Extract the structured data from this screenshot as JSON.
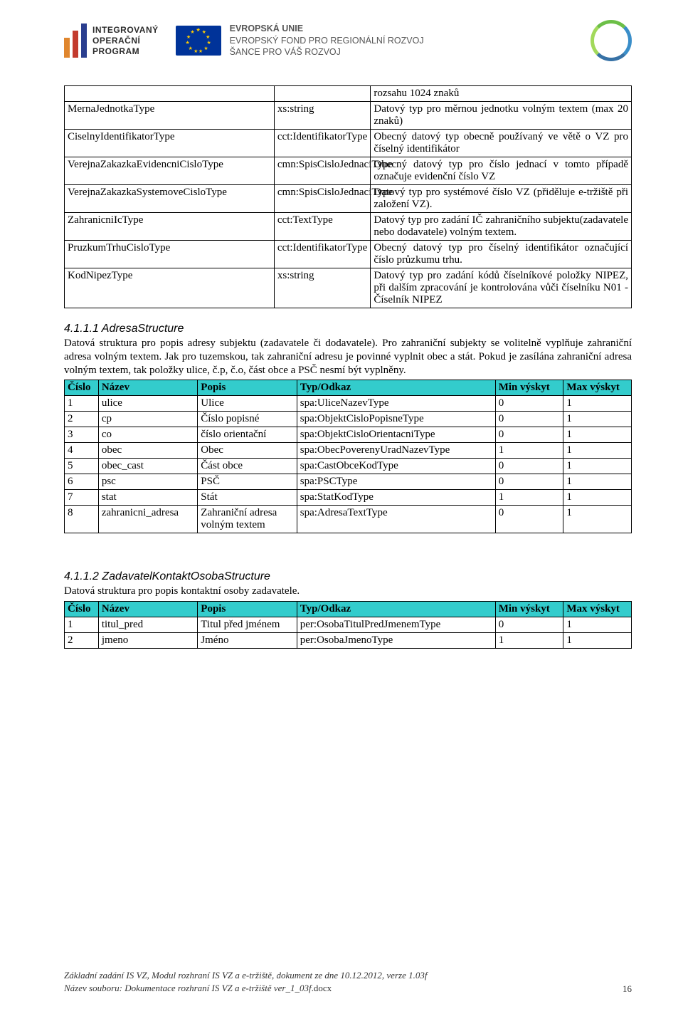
{
  "header": {
    "iop": {
      "l1": "INTEGROVANÝ",
      "l2": "OPERAČNÍ",
      "l3": "PROGRAM"
    },
    "eu": {
      "l1": "EVROPSKÁ UNIE",
      "l2": "EVROPSKÝ FOND PRO REGIONÁLNÍ ROZVOJ",
      "l3": "ŠANCE PRO VÁŠ ROZVOJ"
    }
  },
  "table1": [
    {
      "c1": "",
      "c2": "",
      "c3": "rozsahu 1024 znaků"
    },
    {
      "c1": "MernaJednotkaType",
      "c2": "xs:string",
      "c3": "Datový typ pro měrnou jednotku volným textem (max 20 znaků)"
    },
    {
      "c1": "CiselnyIdentifikatorType",
      "c2": "cct:IdentifikatorType",
      "c3": "Obecný datový typ obecně používaný ve větě o VZ pro číselný identifikátor"
    },
    {
      "c1": "VerejnaZakazkaEvidencniCisloType",
      "c2": "cmn:SpisCisloJednaciType",
      "c3": "Obecný datový typ pro číslo jednací v tomto případě označuje evidenční číslo VZ"
    },
    {
      "c1": "VerejnaZakazkaSystemoveCisloType",
      "c2": "cmn:SpisCisloJednaciType",
      "c3": "Datový typ pro systémové číslo VZ (přiděluje e-tržiště při založení VZ)."
    },
    {
      "c1": "ZahranicniIcType",
      "c2": "cct:TextType",
      "c3": "Datový typ pro zadání IČ zahraničního subjektu(zadavatele nebo dodavatele) volným textem."
    },
    {
      "c1": "PruzkumTrhuCisloType",
      "c2": "cct:IdentifikatorType",
      "c3": "Obecný datový typ pro číselný identifikátor označující číslo průzkumu trhu."
    },
    {
      "c1": "KodNipezType",
      "c2": "xs:string",
      "c3": "Datový typ pro zadání kódů číselníkové položky NIPEZ, při dalším zpracování je kontrolována vůči číselníku N01 - Číselník NIPEZ"
    }
  ],
  "section1": {
    "heading": "4.1.1.1 AdresaStructure",
    "para": "Datová struktura pro popis adresy subjektu (zadavatele či dodavatele). Pro zahraniční subjekty se volitelně vyplňuje zahraniční adresa volným textem. Jak pro tuzemskou, tak zahraniční adresu je povinné vyplnit obec a stát. Pokud je zasílána zahraniční adresa volným textem, tak položky ulice, č.p, č.o, část obce a PSČ nesmí být vyplněny."
  },
  "table2_head": {
    "c1": "Číslo",
    "c2": "Název",
    "c3": "Popis",
    "c4": "Typ/Odkaz",
    "c5": "Min výskyt",
    "c6": "Max výskyt"
  },
  "table2": [
    {
      "n": "1",
      "name": "ulice",
      "desc": "Ulice",
      "type": "spa:UliceNazevType",
      "min": "0",
      "max": "1"
    },
    {
      "n": "2",
      "name": "cp",
      "desc": "Číslo popisné",
      "type": "spa:ObjektCisloPopisneType",
      "min": "0",
      "max": "1"
    },
    {
      "n": "3",
      "name": "co",
      "desc": "číslo orientační",
      "type": "spa:ObjektCisloOrientacniType",
      "min": "0",
      "max": "1"
    },
    {
      "n": "4",
      "name": "obec",
      "desc": "Obec",
      "type": "spa:ObecPoverenyUradNazevType",
      "min": "1",
      "max": "1"
    },
    {
      "n": "5",
      "name": "obec_cast",
      "desc": "Část obce",
      "type": "spa:CastObceKodType",
      "min": "0",
      "max": "1"
    },
    {
      "n": "6",
      "name": "psc",
      "desc": "PSČ",
      "type": "spa:PSCType",
      "min": "0",
      "max": "1"
    },
    {
      "n": "7",
      "name": "stat",
      "desc": "Stát",
      "type": "spa:StatKodType",
      "min": "1",
      "max": "1"
    },
    {
      "n": "8",
      "name": "zahranicni_adresa",
      "desc": "Zahraniční adresa volným textem",
      "type": "spa:AdresaTextType",
      "min": "0",
      "max": "1"
    }
  ],
  "section2": {
    "heading": "4.1.1.2 ZadavatelKontaktOsobaStructure",
    "para": "Datová struktura pro popis kontaktní osoby zadavatele."
  },
  "table3": [
    {
      "n": "1",
      "name": "titul_pred",
      "desc": "Titul před jménem",
      "type": "per:OsobaTitulPredJmenemType",
      "min": "0",
      "max": "1"
    },
    {
      "n": "2",
      "name": "jmeno",
      "desc": "Jméno",
      "type": "per:OsobaJmenoType",
      "min": "1",
      "max": "1"
    }
  ],
  "footer": {
    "l1": "Základní zadání IS VZ, Modul rozhraní IS VZ a e-tržiště, dokument ze dne 10.12.2012, verze 1.03f",
    "l2a": "Název souboru: Dokumentace rozhraní IS VZ a e-tržiště ver_1_03f",
    "l2b": ".docx",
    "page": "16"
  }
}
